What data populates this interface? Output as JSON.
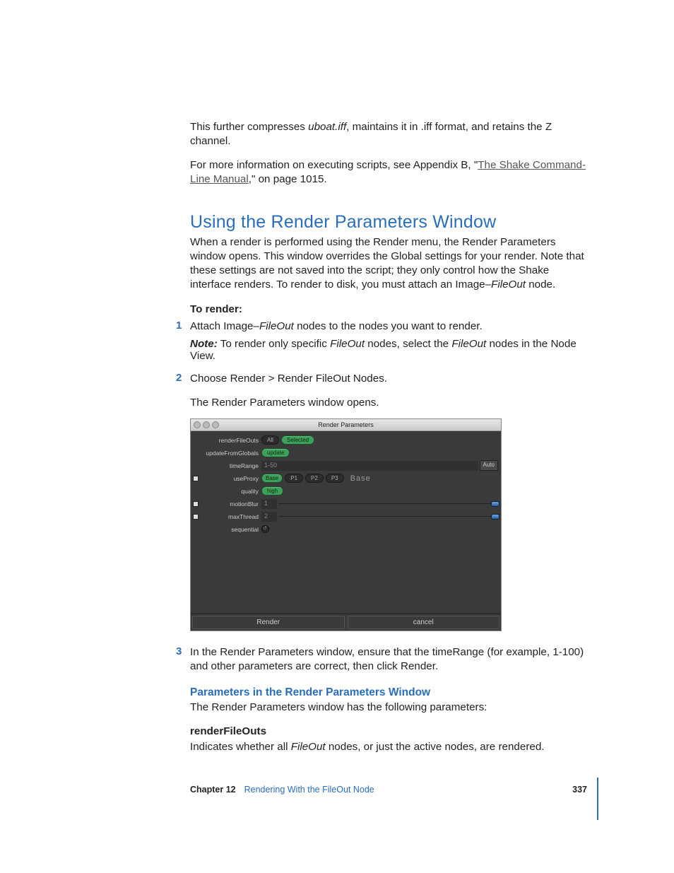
{
  "intro": {
    "p1_a": "This further compresses ",
    "p1_i": "uboat.iff",
    "p1_b": ", maintains it in .iff format, and retains the Z channel.",
    "p2_a": "For more information on executing scripts, see Appendix B, \"",
    "p2_link": "The Shake Command-Line Manual",
    "p2_b": ",\" on page 1015."
  },
  "heading": "Using the Render Parameters Window",
  "heading_p": "When a render is performed using the Render menu, the Render Parameters window opens. This window overrides the Global settings for your render. Note that these settings are not saved into the script; they only control how the Shake interface renders. To render to disk, you must attach an Image–",
  "heading_p_i": "FileOut",
  "heading_p_tail": " node.",
  "to_render": "To render:",
  "steps": {
    "s1_a": "Attach Image–",
    "s1_i": "FileOut",
    "s1_b": " nodes to the nodes you want to render.",
    "note_label": "Note:",
    "note_a": "  To render only specific ",
    "note_i1": "FileOut",
    "note_b": " nodes, select the ",
    "note_i2": "FileOut",
    "note_c": " nodes in the Node View.",
    "s2": "Choose Render > Render FileOut Nodes.",
    "s2_after": "The Render Parameters window opens.",
    "s3": "In the Render Parameters window, ensure that the timeRange (for example, 1-100) and other parameters are correct, then click Render."
  },
  "render_panel": {
    "title": "Render Parameters",
    "labels": {
      "renderFileOuts": "renderFileOuts",
      "updateFromGlobals": "updateFromGlobals",
      "timeRange": "timeRange",
      "useProxy": "useProxy",
      "quality": "quality",
      "motionBlur": "motionBlur",
      "maxThread": "maxThread",
      "sequential": "sequential"
    },
    "values": {
      "all": "All",
      "selected": "Selected",
      "update": "update",
      "timeRange": "1-50",
      "auto": "Auto",
      "basePill": "Base",
      "p1": "P1",
      "p2": "P2",
      "p3": "P3",
      "baseBig": "Base",
      "high": "high",
      "motionBlur": "1",
      "maxThread": "2"
    },
    "footer": {
      "render": "Render",
      "cancel": "cancel"
    }
  },
  "subheading": "Parameters in the Render Parameters Window",
  "sub_p": "The Render Parameters window has the following parameters:",
  "param1_title": "renderFileOuts",
  "param1_a": "Indicates whether all ",
  "param1_i": "FileOut",
  "param1_b": " nodes, or just the active nodes, are rendered.",
  "footer": {
    "chapter": "Chapter 12",
    "title": "Rendering With the FileOut Node",
    "page": "337"
  }
}
